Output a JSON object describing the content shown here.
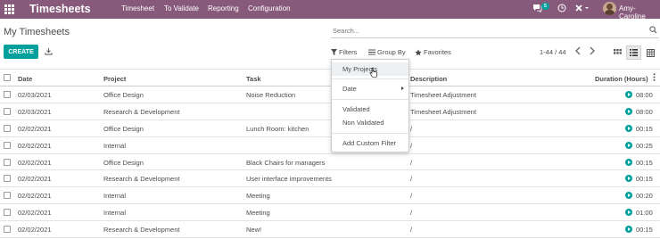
{
  "navbar": {
    "brand": "Timesheets",
    "menu": [
      "Timesheet",
      "To Validate",
      "Reporting",
      "Configuration"
    ],
    "chat_badge": "5",
    "username": "Amy-Caroline",
    "bg_color": "#875a7b"
  },
  "control_panel": {
    "title": "My Timesheets",
    "search_placeholder": "Search...",
    "create_label": "CREATE",
    "filters_label": "Filters",
    "groupby_label": "Group By",
    "favorites_label": "Favorites",
    "pager": "1-44 / 44"
  },
  "filters_menu": {
    "items": [
      "My Projects",
      "Date",
      "Validated",
      "Non Validated",
      "Add Custom Filter"
    ]
  },
  "table": {
    "headers": {
      "date": "Date",
      "project": "Project",
      "task": "Task",
      "description": "Description",
      "duration": "Duration (Hours)"
    },
    "rows": [
      {
        "date": "02/03/2021",
        "project": "Office Design",
        "task": "Noise Reduction",
        "description": "Timesheet Adjustment",
        "duration": "08:00"
      },
      {
        "date": "02/03/2021",
        "project": "Research & Development",
        "task": "",
        "description": "Timesheet Adjustment",
        "duration": "08:00"
      },
      {
        "date": "02/02/2021",
        "project": "Office Design",
        "task": "Lunch Room: kitchen",
        "description": "/",
        "duration": "00:15"
      },
      {
        "date": "02/02/2021",
        "project": "Internal",
        "task": "",
        "description": "/",
        "duration": "00:25"
      },
      {
        "date": "02/02/2021",
        "project": "Office Design",
        "task": "Black Chairs for managers",
        "description": "/",
        "duration": "00:15"
      },
      {
        "date": "02/02/2021",
        "project": "Research & Development",
        "task": "User interface improvements",
        "description": "/",
        "duration": "00:15"
      },
      {
        "date": "02/02/2021",
        "project": "Internal",
        "task": "Meeting",
        "description": "/",
        "duration": "00:20"
      },
      {
        "date": "02/02/2021",
        "project": "Internal",
        "task": "Meeting",
        "description": "/",
        "duration": "01:00"
      },
      {
        "date": "02/02/2021",
        "project": "Research & Development",
        "task": "New!",
        "description": "/",
        "duration": "00:15"
      }
    ]
  },
  "colors": {
    "accent": "#00a09d",
    "brand": "#875a7b"
  }
}
